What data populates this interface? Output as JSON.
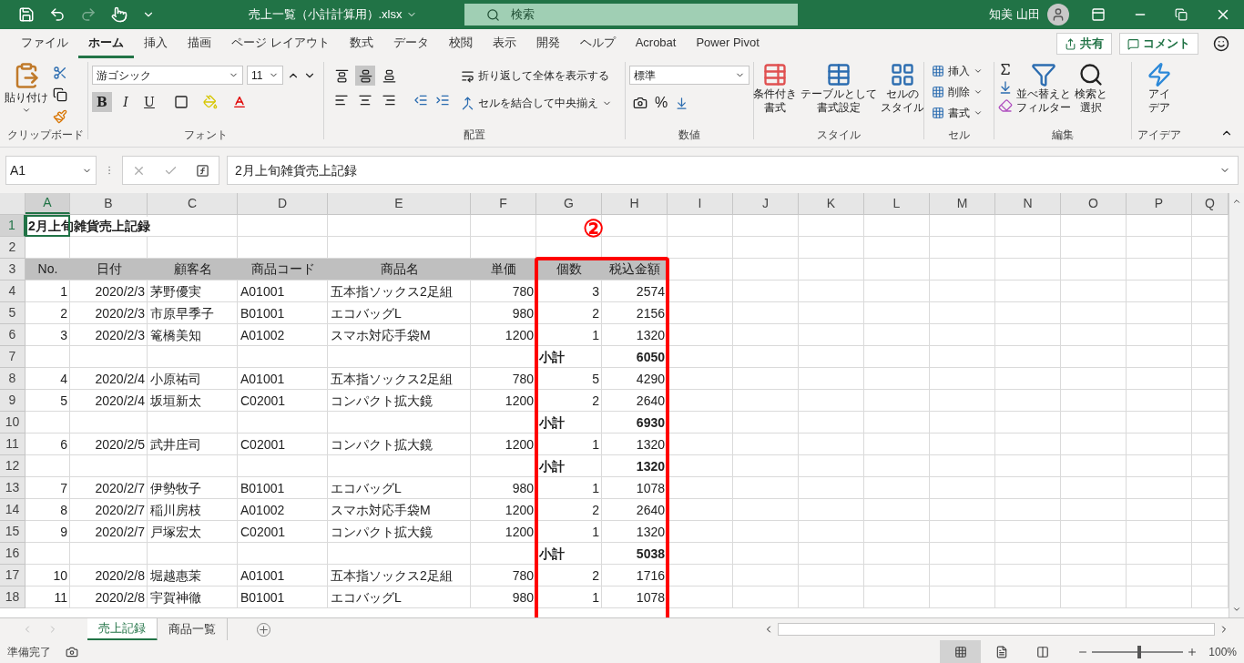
{
  "title_bar": {
    "file_name": "売上一覧（小計計算用）.xlsx",
    "search_placeholder": "検索",
    "user_name": "知美 山田"
  },
  "menu_tabs": [
    {
      "label": "ファイル",
      "selected": false
    },
    {
      "label": "ホーム",
      "selected": true
    },
    {
      "label": "挿入",
      "selected": false
    },
    {
      "label": "描画",
      "selected": false
    },
    {
      "label": "ページ レイアウト",
      "selected": false
    },
    {
      "label": "数式",
      "selected": false
    },
    {
      "label": "データ",
      "selected": false
    },
    {
      "label": "校閲",
      "selected": false
    },
    {
      "label": "表示",
      "selected": false
    },
    {
      "label": "開発",
      "selected": false
    },
    {
      "label": "ヘルプ",
      "selected": false
    },
    {
      "label": "Acrobat",
      "selected": false
    },
    {
      "label": "Power Pivot",
      "selected": false
    }
  ],
  "share_button": "共有",
  "comment_button": "コメント",
  "ribbon": {
    "clipboard": {
      "label": "クリップボード",
      "paste": "貼り付け"
    },
    "font": {
      "label": "フォント",
      "font_name": "游ゴシック",
      "font_size": "11",
      "styles": [
        {
          "label": "B",
          "selected": true
        },
        {
          "label": "I",
          "selected": false
        },
        {
          "label": "U",
          "selected": false
        }
      ]
    },
    "alignment": {
      "label": "配置",
      "vertical": [
        {
          "selected": false
        },
        {
          "selected": true
        },
        {
          "selected": false
        }
      ],
      "wrap": "折り返して全体を表示する",
      "merge": "セルを結合して中央揃え"
    },
    "number": {
      "label": "数値",
      "format": "標準",
      "percent": "%"
    },
    "styles": {
      "label": "スタイル",
      "buttons": [
        {
          "lines": [
            "条件付き",
            "書式"
          ]
        },
        {
          "lines": [
            "テーブルとして",
            "書式設定"
          ]
        },
        {
          "lines": [
            "セルの",
            "スタイル"
          ]
        }
      ]
    },
    "cells": {
      "label": "セル",
      "items": [
        "挿入",
        "削除",
        "書式"
      ]
    },
    "editing": {
      "label": "編集",
      "buttons": [
        {
          "lines": [
            "並べ替えと",
            "フィルター"
          ]
        },
        {
          "lines": [
            "検索と",
            "選択"
          ]
        }
      ]
    },
    "ideas": {
      "label": "アイデア",
      "lines": [
        "アイ",
        "デア"
      ]
    }
  },
  "formula_bar": {
    "name_box": "A1",
    "formula": "2月上旬雑貨売上記録"
  },
  "columns": [
    {
      "label": "A",
      "selected": true
    },
    {
      "label": "B",
      "selected": false
    },
    {
      "label": "C",
      "selected": false
    },
    {
      "label": "D",
      "selected": false
    },
    {
      "label": "E",
      "selected": false
    },
    {
      "label": "F",
      "selected": false
    },
    {
      "label": "G",
      "selected": false
    },
    {
      "label": "H",
      "selected": false
    },
    {
      "label": "I",
      "selected": false
    },
    {
      "label": "J",
      "selected": false
    },
    {
      "label": "K",
      "selected": false
    },
    {
      "label": "L",
      "selected": false
    },
    {
      "label": "M",
      "selected": false
    },
    {
      "label": "N",
      "selected": false
    },
    {
      "label": "O",
      "selected": false
    },
    {
      "label": "P",
      "selected": false
    },
    {
      "label": "Q",
      "selected": false
    }
  ],
  "rows": [
    {
      "number": "1",
      "kind": "title",
      "selected": true,
      "cells": {
        "A": "2月上旬雑貨売上記録"
      }
    },
    {
      "number": "2",
      "kind": "blank",
      "selected": false,
      "cells": {}
    },
    {
      "number": "3",
      "kind": "header",
      "selected": false,
      "cells": {
        "A": "No.",
        "B": "日付",
        "C": "顧客名",
        "D": "商品コード",
        "E": "商品名",
        "F": "単価",
        "G": "個数",
        "H": "税込金額"
      }
    },
    {
      "number": "4",
      "kind": "data",
      "selected": false,
      "cells": {
        "A": "1",
        "B": "2020/2/3",
        "C": "茅野優実",
        "D": "A01001",
        "E": "五本指ソックス2足組",
        "F": "780",
        "G": "3",
        "H": "2574"
      }
    },
    {
      "number": "5",
      "kind": "data",
      "selected": false,
      "cells": {
        "A": "2",
        "B": "2020/2/3",
        "C": "市原早季子",
        "D": "B01001",
        "E": "エコバッグL",
        "F": "980",
        "G": "2",
        "H": "2156"
      }
    },
    {
      "number": "6",
      "kind": "data",
      "selected": false,
      "cells": {
        "A": "3",
        "B": "2020/2/3",
        "C": "篭橋美知",
        "D": "A01002",
        "E": "スマホ対応手袋M",
        "F": "1200",
        "G": "1",
        "H": "1320"
      }
    },
    {
      "number": "7",
      "kind": "subtotal",
      "selected": false,
      "cells": {
        "G": "小計",
        "H": "6050"
      }
    },
    {
      "number": "8",
      "kind": "data",
      "selected": false,
      "cells": {
        "A": "4",
        "B": "2020/2/4",
        "C": "小原祐司",
        "D": "A01001",
        "E": "五本指ソックス2足組",
        "F": "780",
        "G": "5",
        "H": "4290"
      }
    },
    {
      "number": "9",
      "kind": "data",
      "selected": false,
      "cells": {
        "A": "5",
        "B": "2020/2/4",
        "C": "坂垣新太",
        "D": "C02001",
        "E": "コンパクト拡大鏡",
        "F": "1200",
        "G": "2",
        "H": "2640"
      }
    },
    {
      "number": "10",
      "kind": "subtotal",
      "selected": false,
      "cells": {
        "G": "小計",
        "H": "6930"
      }
    },
    {
      "number": "11",
      "kind": "data",
      "selected": false,
      "cells": {
        "A": "6",
        "B": "2020/2/5",
        "C": "武井庄司",
        "D": "C02001",
        "E": "コンパクト拡大鏡",
        "F": "1200",
        "G": "1",
        "H": "1320"
      }
    },
    {
      "number": "12",
      "kind": "subtotal",
      "selected": false,
      "cells": {
        "G": "小計",
        "H": "1320"
      }
    },
    {
      "number": "13",
      "kind": "data",
      "selected": false,
      "cells": {
        "A": "7",
        "B": "2020/2/7",
        "C": "伊勢牧子",
        "D": "B01001",
        "E": "エコバッグL",
        "F": "980",
        "G": "1",
        "H": "1078"
      }
    },
    {
      "number": "14",
      "kind": "data",
      "selected": false,
      "cells": {
        "A": "8",
        "B": "2020/2/7",
        "C": "稲川房枝",
        "D": "A01002",
        "E": "スマホ対応手袋M",
        "F": "1200",
        "G": "2",
        "H": "2640"
      }
    },
    {
      "number": "15",
      "kind": "data",
      "selected": false,
      "cells": {
        "A": "9",
        "B": "2020/2/7",
        "C": "戸塚宏太",
        "D": "C02001",
        "E": "コンパクト拡大鏡",
        "F": "1200",
        "G": "1",
        "H": "1320"
      }
    },
    {
      "number": "16",
      "kind": "subtotal",
      "selected": false,
      "cells": {
        "G": "小計",
        "H": "5038"
      }
    },
    {
      "number": "17",
      "kind": "data",
      "selected": false,
      "cells": {
        "A": "10",
        "B": "2020/2/8",
        "C": "堀越惠茉",
        "D": "A01001",
        "E": "五本指ソックス2足組",
        "F": "780",
        "G": "2",
        "H": "1716"
      }
    },
    {
      "number": "18",
      "kind": "data",
      "selected": false,
      "cells": {
        "A": "11",
        "B": "2020/2/8",
        "C": "宇賀神徹",
        "D": "B01001",
        "E": "エコバッグL",
        "F": "980",
        "G": "1",
        "H": "1078"
      }
    }
  ],
  "callout": "②",
  "sheet_tabs": [
    {
      "label": "売上記録",
      "selected": true
    },
    {
      "label": "商品一覧",
      "selected": false
    }
  ],
  "status_bar": {
    "status": "準備完了",
    "views": [
      {
        "selected": true
      },
      {
        "selected": false
      },
      {
        "selected": false
      }
    ],
    "zoom": {
      "level": 0.5
    },
    "zoom_text": "100%"
  }
}
